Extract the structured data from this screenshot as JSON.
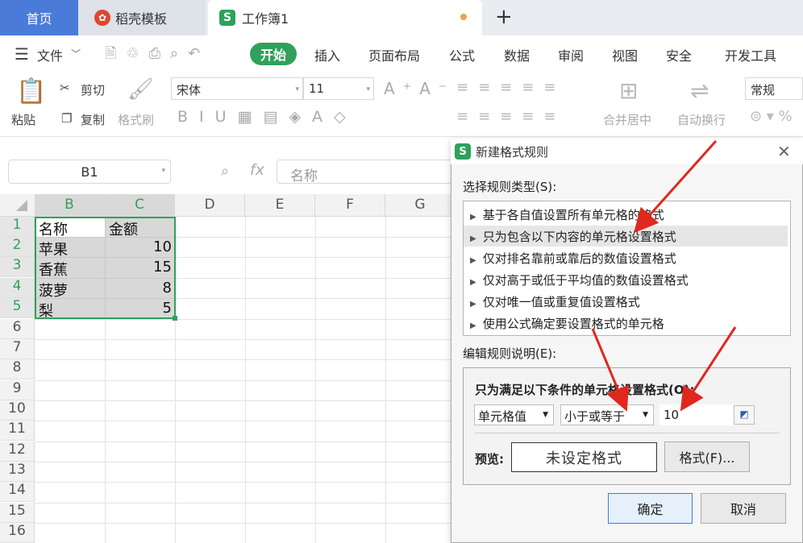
{
  "tabs": {
    "home": "首页",
    "daoke": "稻壳模板",
    "book": "工作簿1",
    "new_tab": "+"
  },
  "menu": {
    "file": "文件",
    "start": "开始",
    "insert": "插入",
    "layout": "页面布局",
    "formula": "公式",
    "data": "数据",
    "review": "审阅",
    "view": "视图",
    "security": "安全",
    "dev": "开发工具"
  },
  "ribbon": {
    "paste": "粘贴",
    "cut": "剪切",
    "copy": "复制",
    "format_painter": "格式刷",
    "font": "宋体",
    "size": "11",
    "merge": "合并居中",
    "wrap": "自动换行",
    "number_format": "常规"
  },
  "formula_bar": {
    "cell_ref": "B1",
    "fx": "fx",
    "placeholder": "名称"
  },
  "columns": [
    "B",
    "C",
    "D",
    "E",
    "F",
    "G"
  ],
  "rows": [
    "1",
    "2",
    "3",
    "4",
    "5",
    "6",
    "7",
    "8",
    "9",
    "10",
    "11",
    "12",
    "13",
    "14",
    "15",
    "16"
  ],
  "table": [
    {
      "name": "名称",
      "amount": "金额"
    },
    {
      "name": "苹果",
      "amount": "10"
    },
    {
      "name": "香蕉",
      "amount": "15"
    },
    {
      "name": "菠萝",
      "amount": "8"
    },
    {
      "name": "梨",
      "amount": "5"
    }
  ],
  "dialog": {
    "title": "新建格式规则",
    "rule_type_label": "选择规则类型(S):",
    "rules": [
      "基于各自值设置所有单元格的格式",
      "只为包含以下内容的单元格设置格式",
      "仅对排名靠前或靠后的数值设置格式",
      "仅对高于或低于平均值的数值设置格式",
      "仅对唯一值或重复值设置格式",
      "使用公式确定要设置格式的单元格"
    ],
    "edit_label": "编辑规则说明(E):",
    "condition_title": "只为满足以下条件的单元格设置格式(O):",
    "cond_field": "单元格值",
    "cond_operator": "小于或等于",
    "cond_value": "10",
    "preview_label": "预览:",
    "preview_text": "未设定格式",
    "format_button": "格式(F)...",
    "ok": "确定",
    "cancel": "取消"
  },
  "colors": {
    "accent_green": "#2fa15b",
    "tab_blue": "#4a7bd9",
    "arrow_red": "#e0281f"
  }
}
